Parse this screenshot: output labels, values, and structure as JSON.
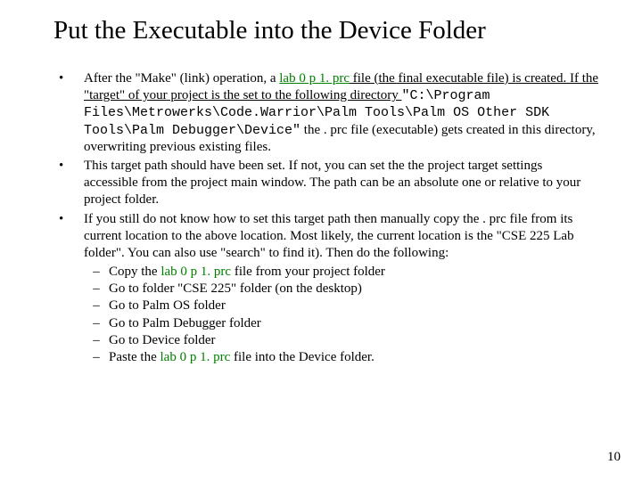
{
  "title": "Put the Executable into the Device Folder",
  "bullets": [
    {
      "prefix1": "After the \"Make\" (link) operation, a ",
      "prc": "lab 0 p 1. prc",
      "after_prc": " file (the final executable file) is created. If the \"target\" of your project is the set to the following directory ",
      "path": "\"C:\\Program Files\\Metrowerks\\Code.Warrior\\Palm Tools\\Palm OS Other SDK Tools\\Palm Debugger\\Device\"",
      "tail": " the . prc file (executable) gets created in this directory, overwriting previous existing files."
    },
    {
      "text": "This target path should have been set. If not, you can set the the project target settings accessible from the project main window. The path can be an absolute one or relative to your project folder."
    },
    {
      "text": "If you still do not know how to set this target path then manually copy the . prc file from its current location to the above location. Most likely, the current location is the \"CSE 225 Lab folder\". You can also use \"search\" to find it). Then do the following:",
      "sub": [
        {
          "pre": "Copy the ",
          "prc": "lab 0 p 1. prc",
          "post": " file from your project folder"
        },
        {
          "text": "Go to folder \"CSE 225\" folder (on the desktop)"
        },
        {
          "text": "Go to Palm OS folder"
        },
        {
          "text": "Go to Palm Debugger folder"
        },
        {
          "text": "Go to Device folder"
        },
        {
          "pre": "Paste the ",
          "prc": "lab 0 p 1. prc",
          "post": " file into the Device folder."
        }
      ]
    }
  ],
  "page_number": "10"
}
